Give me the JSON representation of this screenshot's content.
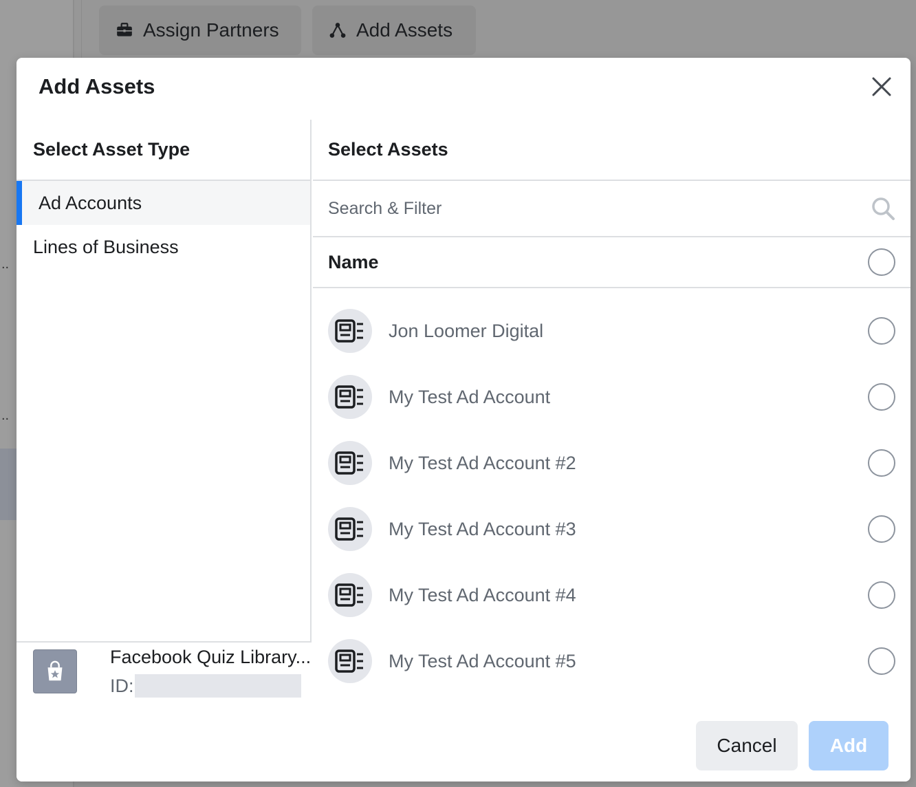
{
  "background": {
    "buttons": [
      {
        "label": "Assign Partners",
        "icon": "briefcase-icon"
      },
      {
        "label": "Add Assets",
        "icon": "nodes-icon"
      }
    ]
  },
  "modal": {
    "title": "Add Assets",
    "close_icon": "close-icon",
    "left_pane": {
      "heading": "Select Asset Type",
      "types": [
        {
          "label": "Ad Accounts",
          "active": true
        },
        {
          "label": "Lines of Business",
          "active": false
        }
      ],
      "business": {
        "name": "Facebook Quiz Library...",
        "id_label": "ID:",
        "icon": "shopping-bag-star-icon"
      }
    },
    "right_pane": {
      "heading": "Select Assets",
      "search_placeholder": "Search & Filter",
      "search_icon": "search-icon",
      "column_header": "Name",
      "assets": [
        {
          "name": "Jon Loomer Digital",
          "icon": "ad-account-icon"
        },
        {
          "name": "My Test Ad Account",
          "icon": "ad-account-icon"
        },
        {
          "name": "My Test Ad Account #2",
          "icon": "ad-account-icon"
        },
        {
          "name": "My Test Ad Account #3",
          "icon": "ad-account-icon"
        },
        {
          "name": "My Test Ad Account #4",
          "icon": "ad-account-icon"
        },
        {
          "name": "My Test Ad Account #5",
          "icon": "ad-account-icon"
        }
      ]
    },
    "footer": {
      "cancel_label": "Cancel",
      "add_label": "Add"
    }
  },
  "colors": {
    "accent": "#1877f2",
    "add_disabled": "#aed1fb",
    "overlay": "#979797"
  }
}
